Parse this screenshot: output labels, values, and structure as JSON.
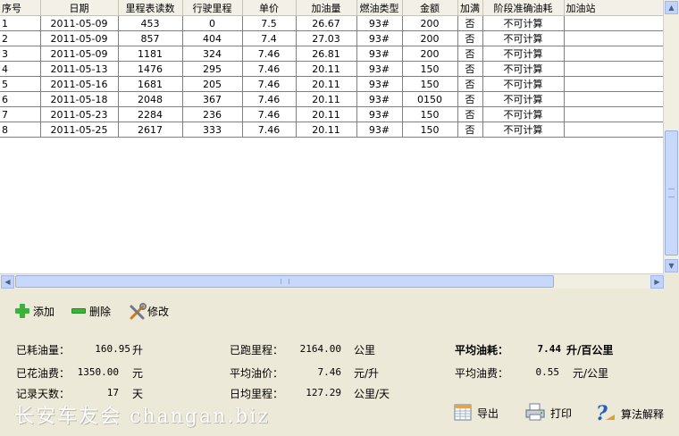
{
  "grid": {
    "columns": [
      "序号",
      "日期",
      "里程表读数",
      "行驶里程",
      "单价",
      "加油量",
      "燃油类型",
      "金额",
      "加满",
      "阶段准确油耗",
      "加油站"
    ],
    "rows": [
      [
        "1",
        "2011-05-09",
        "453",
        "0",
        "7.5",
        "26.67",
        "93#",
        "200",
        "否",
        "不可计算",
        ""
      ],
      [
        "2",
        "2011-05-09",
        "857",
        "404",
        "7.4",
        "27.03",
        "93#",
        "200",
        "否",
        "不可计算",
        ""
      ],
      [
        "3",
        "2011-05-09",
        "1181",
        "324",
        "7.46",
        "26.81",
        "93#",
        "200",
        "否",
        "不可计算",
        ""
      ],
      [
        "4",
        "2011-05-13",
        "1476",
        "295",
        "7.46",
        "20.11",
        "93#",
        "150",
        "否",
        "不可计算",
        ""
      ],
      [
        "5",
        "2011-05-16",
        "1681",
        "205",
        "7.46",
        "20.11",
        "93#",
        "150",
        "否",
        "不可计算",
        ""
      ],
      [
        "6",
        "2011-05-18",
        "2048",
        "367",
        "7.46",
        "20.11",
        "93#",
        "0150",
        "否",
        "不可计算",
        ""
      ],
      [
        "7",
        "2011-05-23",
        "2284",
        "236",
        "7.46",
        "20.11",
        "93#",
        "150",
        "否",
        "不可计算",
        ""
      ],
      [
        "8",
        "2011-05-25",
        "2617",
        "333",
        "7.46",
        "20.11",
        "93#",
        "150",
        "否",
        "不可计算",
        ""
      ]
    ]
  },
  "toolbar": {
    "add": {
      "label": "添加",
      "icon": "plus-icon",
      "color": "#3bb33b"
    },
    "delete": {
      "label": "删除",
      "icon": "minus-icon",
      "color": "#3bb33b"
    },
    "edit": {
      "label": "修改",
      "icon": "tools-icon"
    }
  },
  "stats": {
    "fuel_used": {
      "label": "已耗油量：",
      "value": "160.95",
      "unit": "升"
    },
    "fuel_cost": {
      "label": "已花油费：",
      "value": "1350.00",
      "unit": "元"
    },
    "record_days": {
      "label": "记录天数：",
      "value": "17",
      "unit": "天"
    },
    "distance": {
      "label": "已跑里程：",
      "value": "2164.00",
      "unit": "公里"
    },
    "avg_price": {
      "label": "平均油价：",
      "value": "7.46",
      "unit": "元/升"
    },
    "daily_distance": {
      "label": "日均里程：",
      "value": "127.29",
      "unit": "公里/天"
    },
    "avg_consumption": {
      "label": "平均油耗：",
      "value": "7.44",
      "unit": "升/百公里"
    },
    "avg_cost": {
      "label": "平均油费：",
      "value": "0.55",
      "unit": "元/公里"
    }
  },
  "buttons": {
    "export": {
      "label": "导出",
      "icon": "spreadsheet-icon"
    },
    "print": {
      "label": "打印",
      "icon": "printer-icon"
    },
    "explain": {
      "label": "算法解释",
      "icon": "help-icon"
    }
  },
  "watermark": "长安车友会 changan.biz"
}
